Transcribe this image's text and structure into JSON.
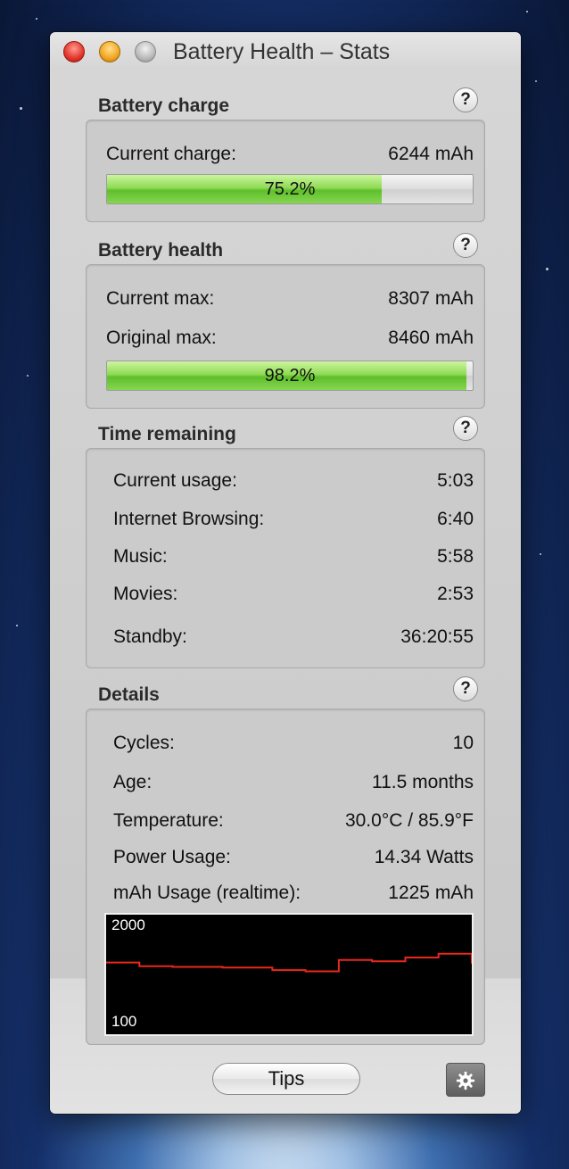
{
  "window": {
    "title": "Battery Health – Stats"
  },
  "battery_charge": {
    "title": "Battery charge",
    "current_label": "Current charge:",
    "current_value": "6244 mAh",
    "percent_text": "75.2%",
    "percent": 75.2
  },
  "battery_health": {
    "title": "Battery health",
    "current_max_label": "Current max:",
    "current_max_value": "8307 mAh",
    "original_max_label": "Original max:",
    "original_max_value": "8460 mAh",
    "percent_text": "98.2%",
    "percent": 98.2
  },
  "time_remaining": {
    "title": "Time remaining",
    "rows": [
      {
        "label": "Current usage:",
        "value": "5:03"
      },
      {
        "label": "Internet Browsing:",
        "value": "6:40"
      },
      {
        "label": "Music:",
        "value": "5:58"
      },
      {
        "label": "Movies:",
        "value": "2:53"
      },
      {
        "label": "Standby:",
        "value": "36:20:55"
      }
    ]
  },
  "details": {
    "title": "Details",
    "rows": [
      {
        "label": "Cycles:",
        "value": "10"
      },
      {
        "label": "Age:",
        "value": "11.5 months"
      },
      {
        "label": "Temperature:",
        "value": "30.0°C / 85.9°F"
      },
      {
        "label": "Power Usage:",
        "value": "14.34 Watts"
      },
      {
        "label": "mAh Usage (realtime):",
        "value": "1225 mAh"
      }
    ],
    "chart_top_label": "2000",
    "chart_bottom_label": "100"
  },
  "chart_data": {
    "type": "line",
    "title": "",
    "xlabel": "",
    "ylabel": "",
    "ylim": [
      100,
      2000
    ],
    "series": [
      {
        "color": "#e8281e",
        "values": [
          1240,
          1240,
          1180,
          1180,
          1170,
          1170,
          1170,
          1160,
          1160,
          1160,
          1120,
          1120,
          1100,
          1100,
          1280,
          1280,
          1260,
          1260,
          1320,
          1320,
          1380,
          1380,
          1225
        ]
      }
    ],
    "grid": false,
    "legend": "none"
  },
  "buttons": {
    "tips_label": "Tips"
  },
  "icons": {
    "help": "question-mark-icon",
    "gear": "gear-icon"
  },
  "colors": {
    "bar_green": "#6cc93a",
    "chart_line": "#e8281e",
    "chart_bg": "#000000"
  }
}
